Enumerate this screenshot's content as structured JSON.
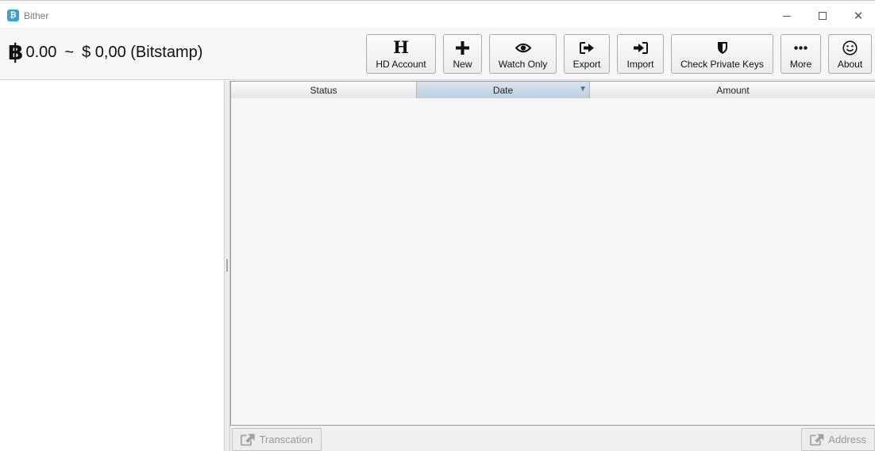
{
  "window": {
    "title": "Bither",
    "app_icon_glyph": "₿"
  },
  "header": {
    "btc_symbol": "฿",
    "btc_balance": "0.00",
    "separator": "~",
    "fiat_balance": "$ 0,00 (Bitstamp)"
  },
  "toolbar": {
    "hd_account": "HD Account",
    "new": "New",
    "watch_only": "Watch Only",
    "export": "Export",
    "import": "Import",
    "check_private_keys": "Check Private Keys",
    "more": "More",
    "about": "About"
  },
  "table": {
    "columns": [
      "Status",
      "Date",
      "Amount"
    ],
    "sorted_column": "Date",
    "sort_indicator": "▼",
    "rows": []
  },
  "footer": {
    "transaction_label": "Transcation",
    "address_label": "Address"
  },
  "icons": {
    "hd_account": "h-letter-icon",
    "new": "plus-icon",
    "watch_only": "eye-icon",
    "export": "export-icon",
    "import": "import-icon",
    "check_private_keys": "shield-icon",
    "more": "more-dots-icon",
    "about": "smiley-icon",
    "transaction": "external-link-icon",
    "address": "external-link-icon"
  },
  "colors": {
    "app_icon": "#3aa0d8",
    "sorted_header": "#c5d6e6"
  }
}
